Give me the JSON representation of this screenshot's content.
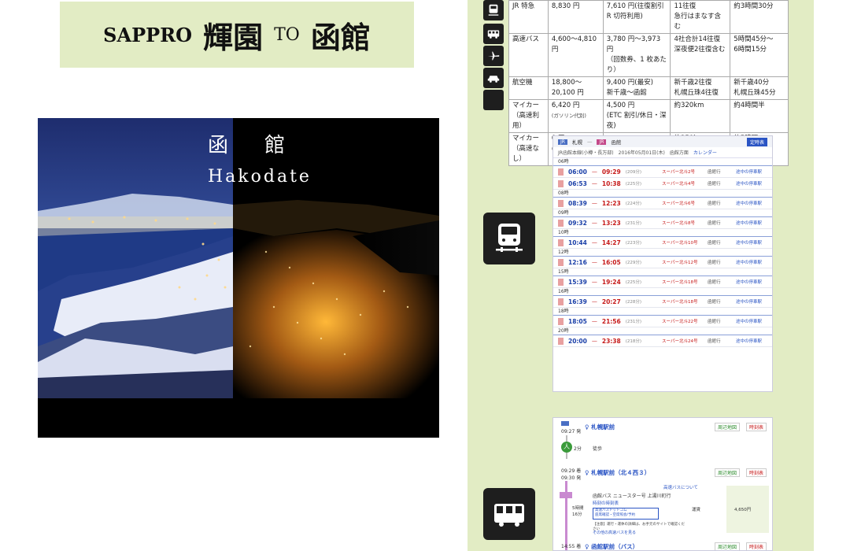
{
  "title": {
    "from": "SAPPRO",
    "from_jp": "輝園",
    "to_word": "TO",
    "to_jp": "函館"
  },
  "photo": {
    "title_jp": "函館",
    "title_en": "Hakodate"
  },
  "fare_table": {
    "rows": [
      {
        "icon": "train-icon",
        "mode": "JR 特急",
        "mode_note": "",
        "fare": "8,830 円",
        "fare_note": "",
        "discount": "7,610 円(往復割引",
        "discount2": "R 切符利用)",
        "frequency": "11往復",
        "frequency2": "急行はまなす含む",
        "duration": "約3時間30分",
        "duration2": ""
      },
      {
        "icon": "bus-icon",
        "mode": "高速バス",
        "mode_note": "",
        "fare": "4,600〜4,810 円",
        "fare_note": "",
        "discount": "3,780 円～3,973 円",
        "discount2": "（回数券、1 枚あたり）",
        "frequency": "4社合計14往復",
        "frequency2": "深夜便2往復含む",
        "duration": "5時間45分～",
        "duration2": "6時間15分"
      },
      {
        "icon": "plane-icon",
        "mode": "航空機",
        "mode_note": "",
        "fare": "18,800〜20,100 円",
        "fare_note": "",
        "discount": "9,400 円(最安)",
        "discount2": "新千歳〜函館",
        "frequency": "新千歳2往復",
        "frequency2": "札幌丘珠4往復",
        "duration": "新千歳40分",
        "duration2": "札幌丘珠45分"
      },
      {
        "icon": "car-icon",
        "mode": "マイカー",
        "mode_note": "（高速利用）",
        "fare": "6,420 円",
        "fare_note": "(ガソリン代別)",
        "discount": "4,500 円",
        "discount2": "(ETC 割引/休日・深夜)",
        "frequency": "約320km",
        "frequency2": "",
        "duration": "約4時間半",
        "duration2": ""
      },
      {
        "icon": "blank-icon",
        "mode": "マイカー",
        "mode_note": "（高速なし）",
        "fare": "0 円",
        "fare_note": "(ガソリン代別)",
        "discount": "",
        "discount2": "",
        "frequency": "約250km",
        "frequency2": "",
        "duration": "約5時間",
        "duration2": ""
      }
    ]
  },
  "timetable": {
    "from_tag": "JR",
    "from": "札幌",
    "to_tag": "JR",
    "to": "函館",
    "line": "JR函館本線(小樽・長万部)",
    "date": "2016年05月01日(木)",
    "direction": "函館方面",
    "calendar": "カレンダー",
    "button": "定時表",
    "rows": [
      {
        "hour": "06時",
        "dep": "06:00",
        "arr": "09:29",
        "dur": "(209分)",
        "train": "スーパー北斗2号",
        "dest": "函館行",
        "link": "途中の停車駅"
      },
      {
        "hour": "",
        "dep": "06:53",
        "arr": "10:38",
        "dur": "(225分)",
        "train": "スーパー北斗4号",
        "dest": "函館行",
        "link": "途中の停車駅"
      },
      {
        "hour": "08時",
        "dep": "08:39",
        "arr": "12:23",
        "dur": "(224分)",
        "train": "スーパー北斗6号",
        "dest": "函館行",
        "link": "途中の停車駅"
      },
      {
        "hour": "09時",
        "dep": "09:32",
        "arr": "13:23",
        "dur": "(231分)",
        "train": "スーパー北斗8号",
        "dest": "函館行",
        "link": "途中の停車駅"
      },
      {
        "hour": "10時",
        "dep": "10:44",
        "arr": "14:27",
        "dur": "(223分)",
        "train": "スーパー北斗10号",
        "dest": "函館行",
        "link": "途中の停車駅"
      },
      {
        "hour": "12時",
        "dep": "12:16",
        "arr": "16:05",
        "dur": "(229分)",
        "train": "スーパー北斗12号",
        "dest": "函館行",
        "link": "途中の停車駅"
      },
      {
        "hour": "15時",
        "dep": "15:39",
        "arr": "19:24",
        "dur": "(225分)",
        "train": "スーパー北斗18号",
        "dest": "函館行",
        "link": "途中の停車駅"
      },
      {
        "hour": "16時",
        "dep": "16:39",
        "arr": "20:27",
        "dur": "(228分)",
        "train": "スーパー北斗18号",
        "dest": "函館行",
        "link": "途中の停車駅"
      },
      {
        "hour": "18時",
        "dep": "18:05",
        "arr": "21:56",
        "dur": "(231分)",
        "train": "スーパー北斗22号",
        "dest": "函館行",
        "link": "途中の停車駅"
      },
      {
        "hour": "20時",
        "dep": "20:00",
        "arr": "23:38",
        "dur": "(218分)",
        "train": "スーパー北斗24号",
        "dest": "函館行",
        "link": "途中の停車駅"
      }
    ]
  },
  "bus_route": {
    "start_time": "09:27",
    "start_time_label": "発",
    "start_stop": "札幌駅前",
    "walk_label": "徒歩",
    "walk_time": "2分",
    "arrive_time": "09:29",
    "arrive_label": "着",
    "depart_time": "09:30",
    "depart_label": "発",
    "stop2": "札幌駅前（北４西３）",
    "bus_name": "函館バス ニュースター号 上湯川町行",
    "bus_about": "高速バスについて",
    "timetable_link": "時刻の時刻表",
    "reserve": "高速バスドットコム\n座席確認・空席照会/予約",
    "note": "【注意】運行・運休の詳細は、お手元のサイトで確認ください",
    "other_link": "その他の高速バスを見る",
    "fare_label": "運賃",
    "fare": "4,650円",
    "duration": "5時間16分",
    "end_time": "14:55",
    "end_label": "着",
    "end_stop": "函館駅前（バス）",
    "btn_map": "周辺地図",
    "btn_time": "時刻表"
  },
  "colors": {
    "panel_green": "#e2ecc4",
    "link_blue": "#2a54c4",
    "arrival_red": "#c61a1a"
  }
}
